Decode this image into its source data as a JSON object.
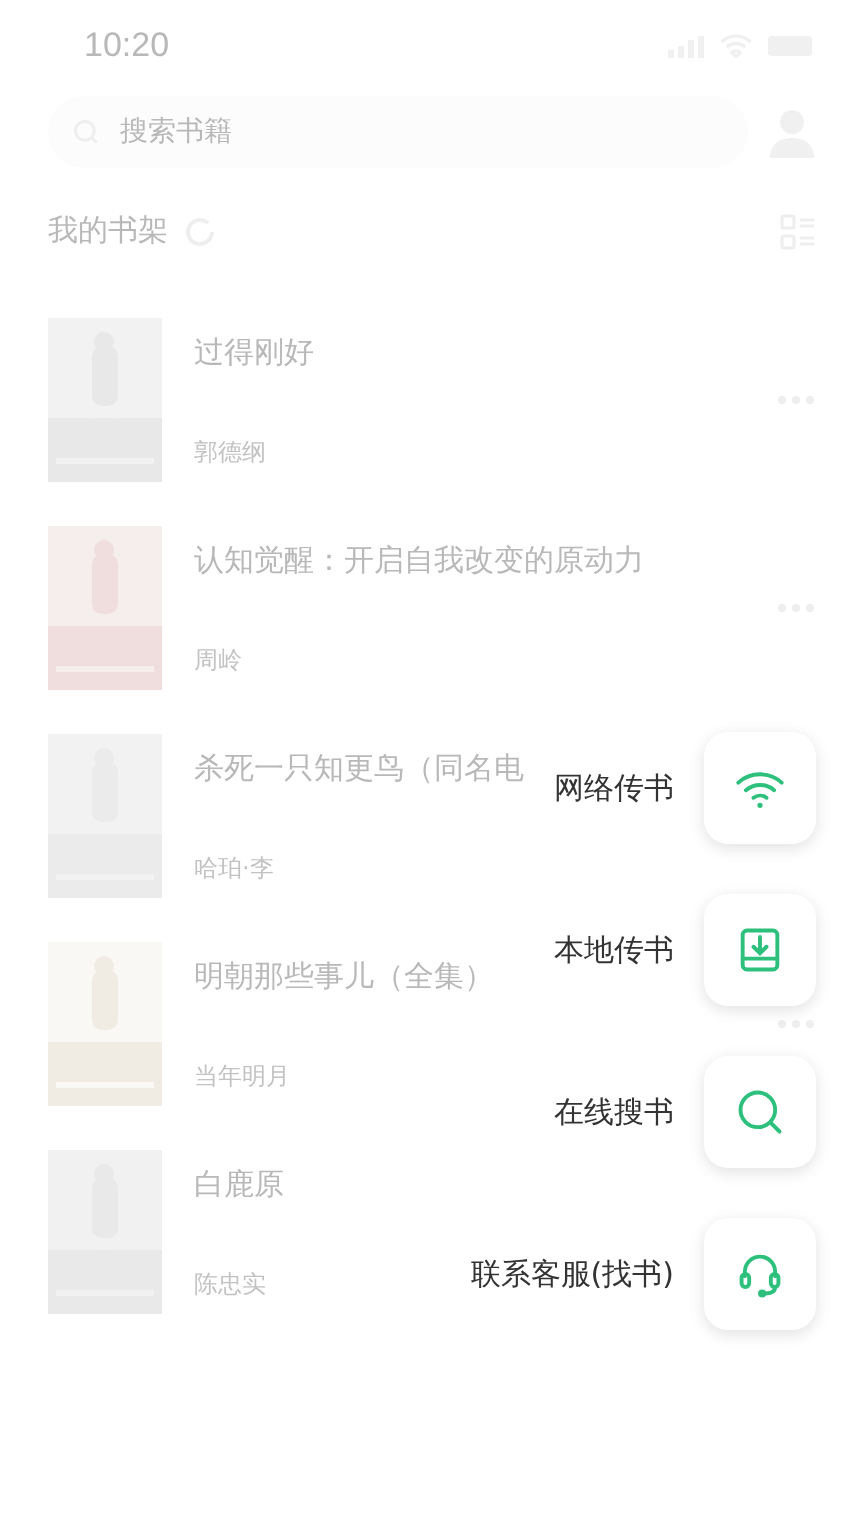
{
  "status_bar": {
    "time": "10:20"
  },
  "search": {
    "placeholder": "搜索书籍"
  },
  "shelf": {
    "title": "我的书架"
  },
  "books": [
    {
      "title": "过得刚好",
      "author": "郭德纲",
      "has_more": true
    },
    {
      "title": "认知觉醒：开启自我改变的原动力",
      "author": "周岭",
      "has_more": true
    },
    {
      "title": "杀死一只知更鸟（同名电",
      "author": "哈珀·李",
      "has_more": false
    },
    {
      "title": "明朝那些事儿（全集）",
      "author": "当年明月",
      "has_more": true
    },
    {
      "title": "白鹿原",
      "author": "陈忠实",
      "has_more": false
    }
  ],
  "menu": [
    {
      "kind": "wifi",
      "label": "网络传书"
    },
    {
      "kind": "download",
      "label": "本地传书"
    },
    {
      "kind": "search",
      "label": "在线搜书"
    },
    {
      "kind": "headset",
      "label": "联系客服(找书)"
    }
  ]
}
